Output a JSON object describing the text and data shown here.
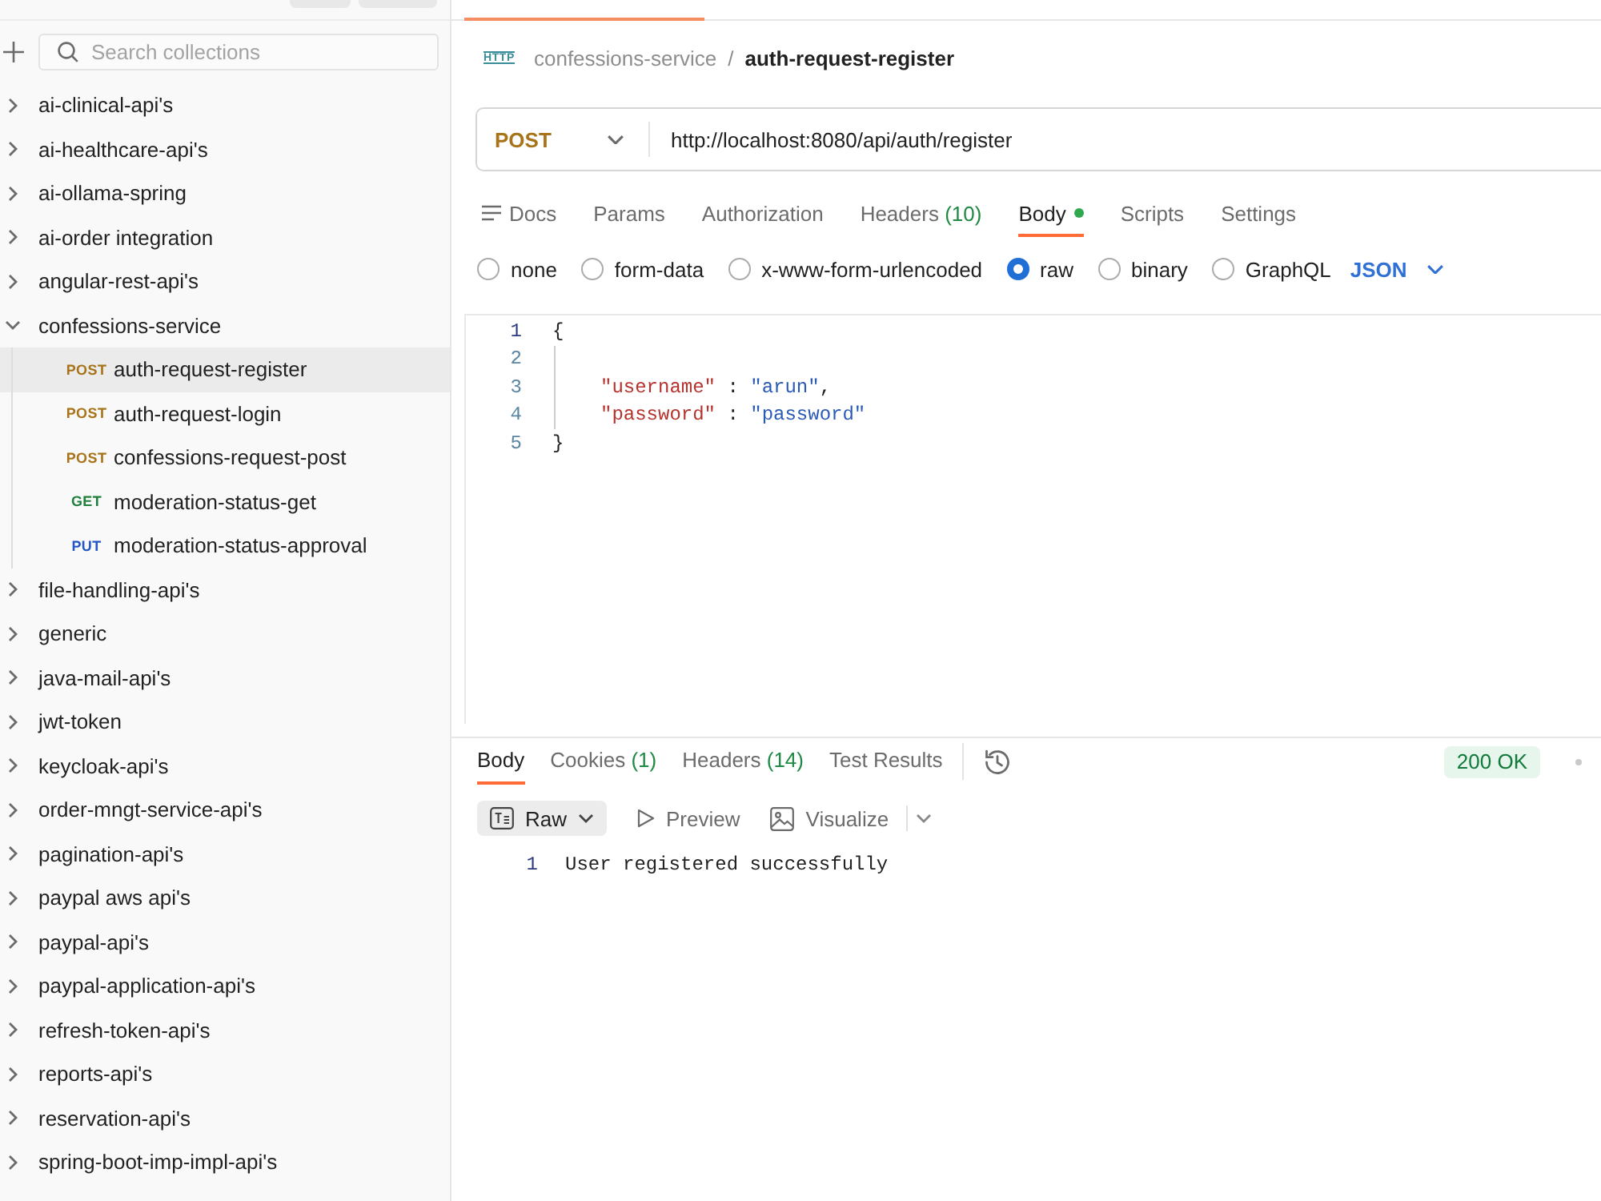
{
  "sidebar": {
    "search": {
      "placeholder": "Search collections"
    },
    "collections": [
      {
        "name": "ai-clinical-api's",
        "expanded": false
      },
      {
        "name": "ai-healthcare-api's",
        "expanded": false
      },
      {
        "name": "ai-ollama-spring",
        "expanded": false
      },
      {
        "name": "ai-order integration",
        "expanded": false
      },
      {
        "name": "angular-rest-api's",
        "expanded": false
      },
      {
        "name": "confessions-service",
        "expanded": true,
        "children": [
          {
            "method": "POST",
            "color": "#a8741a",
            "name": "auth-request-register",
            "selected": true
          },
          {
            "method": "POST",
            "color": "#a8741a",
            "name": "auth-request-login",
            "selected": false
          },
          {
            "method": "POST",
            "color": "#a8741a",
            "name": "confessions-request-post",
            "selected": false
          },
          {
            "method": "GET",
            "color": "#1f7f3b",
            "name": "moderation-status-get",
            "selected": false
          },
          {
            "method": "PUT",
            "color": "#2358c4",
            "name": "moderation-status-approval",
            "selected": false
          }
        ]
      },
      {
        "name": "file-handling-api's",
        "expanded": false
      },
      {
        "name": "generic",
        "expanded": false
      },
      {
        "name": "java-mail-api's",
        "expanded": false
      },
      {
        "name": "jwt-token",
        "expanded": false
      },
      {
        "name": "keycloak-api's",
        "expanded": false
      },
      {
        "name": "order-mngt-service-api's",
        "expanded": false
      },
      {
        "name": "pagination-api's",
        "expanded": false
      },
      {
        "name": "paypal aws api's",
        "expanded": false
      },
      {
        "name": "paypal-api's",
        "expanded": false
      },
      {
        "name": "paypal-application-api's",
        "expanded": false
      },
      {
        "name": "refresh-token-api's",
        "expanded": false
      },
      {
        "name": "reports-api's",
        "expanded": false
      },
      {
        "name": "reservation-api's",
        "expanded": false
      },
      {
        "name": "spring-boot-imp-impl-api's",
        "expanded": false
      }
    ]
  },
  "request": {
    "type_label": "HTTP",
    "breadcrumb": {
      "parent": "confessions-service",
      "separator": "/",
      "current": "auth-request-register"
    },
    "method": "POST",
    "url": "http://localhost:8080/api/auth/register",
    "tabs": [
      {
        "label": "Docs",
        "kind": "docs",
        "selected": false,
        "modified": false
      },
      {
        "label": "Params",
        "kind": "plain",
        "selected": false,
        "modified": false
      },
      {
        "label": "Authorization",
        "kind": "plain",
        "selected": false,
        "modified": false
      },
      {
        "label": "Headers",
        "count": "(10)",
        "kind": "plain",
        "selected": false,
        "modified": false
      },
      {
        "label": "Body",
        "kind": "plain",
        "selected": true,
        "modified": true
      },
      {
        "label": "Scripts",
        "kind": "plain",
        "selected": false,
        "modified": false
      },
      {
        "label": "Settings",
        "kind": "plain",
        "selected": false,
        "modified": false
      }
    ],
    "body_modes": [
      {
        "label": "none",
        "selected": false
      },
      {
        "label": "form-data",
        "selected": false
      },
      {
        "label": "x-www-form-urlencoded",
        "selected": false
      },
      {
        "label": "raw",
        "selected": true
      },
      {
        "label": "binary",
        "selected": false
      },
      {
        "label": "GraphQL",
        "selected": false
      }
    ],
    "body_language": "JSON",
    "editor": {
      "lines": [
        {
          "number": "1",
          "active": true,
          "tokens": [
            {
              "kind": "punct",
              "text": "{"
            }
          ],
          "children": [
            {
              "number": "2",
              "active": false
            },
            {
              "number": "3",
              "active": false,
              "tokens": [
                {
                  "kind": "key",
                  "text": "\"username\""
                },
                {
                  "kind": "punct",
                  "text": " : "
                },
                {
                  "kind": "string",
                  "text": "\"arun\""
                },
                {
                  "kind": "punct",
                  "text": ","
                }
              ]
            },
            {
              "number": "4",
              "active": false,
              "tokens": [
                {
                  "kind": "key",
                  "text": "\"password\""
                },
                {
                  "kind": "punct",
                  "text": " : "
                },
                {
                  "kind": "string",
                  "text": "\"password\""
                }
              ]
            }
          ]
        },
        {
          "number": "5",
          "active": false,
          "tokens": [
            {
              "kind": "punct",
              "text": "}"
            }
          ]
        }
      ]
    }
  },
  "response": {
    "tabs": [
      {
        "label": "Body",
        "selected": true
      },
      {
        "label": "Cookies",
        "count": "(1)",
        "selected": false
      },
      {
        "label": "Headers",
        "count": "(14)",
        "selected": false
      },
      {
        "label": "Test Results",
        "selected": false
      }
    ],
    "status": "200 OK",
    "view_modes": [
      {
        "label": "Raw",
        "kind": "raw",
        "selected": true
      },
      {
        "label": "Preview",
        "kind": "preview",
        "selected": false
      },
      {
        "label": "Visualize",
        "kind": "visualize",
        "selected": false
      }
    ],
    "body_lines": [
      {
        "number": "1",
        "text": "User registered successfully"
      }
    ]
  }
}
